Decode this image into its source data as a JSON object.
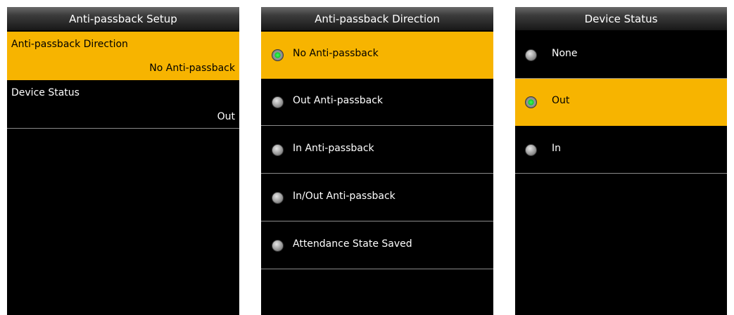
{
  "setup_screen": {
    "title": "Anti-passback Setup",
    "items": [
      {
        "label": "Anti-passback Direction",
        "value": "No Anti-passback",
        "selected": true
      },
      {
        "label": "Device Status",
        "value": "Out",
        "selected": false
      }
    ]
  },
  "direction_screen": {
    "title": "Anti-passback Direction",
    "options": [
      {
        "label": "No Anti-passback",
        "checked": true
      },
      {
        "label": "Out Anti-passback",
        "checked": false
      },
      {
        "label": "In Anti-passback",
        "checked": false
      },
      {
        "label": "In/Out Anti-passback",
        "checked": false
      },
      {
        "label": "Attendance State Saved",
        "checked": false
      }
    ]
  },
  "status_screen": {
    "title": "Device Status",
    "options": [
      {
        "label": "None",
        "checked": false
      },
      {
        "label": "Out",
        "checked": true
      },
      {
        "label": "In",
        "checked": false
      }
    ]
  },
  "colors": {
    "highlight": "#f7b400",
    "background": "#000000",
    "divider": "#8a8a8a",
    "radio_on": "#19c52e"
  }
}
